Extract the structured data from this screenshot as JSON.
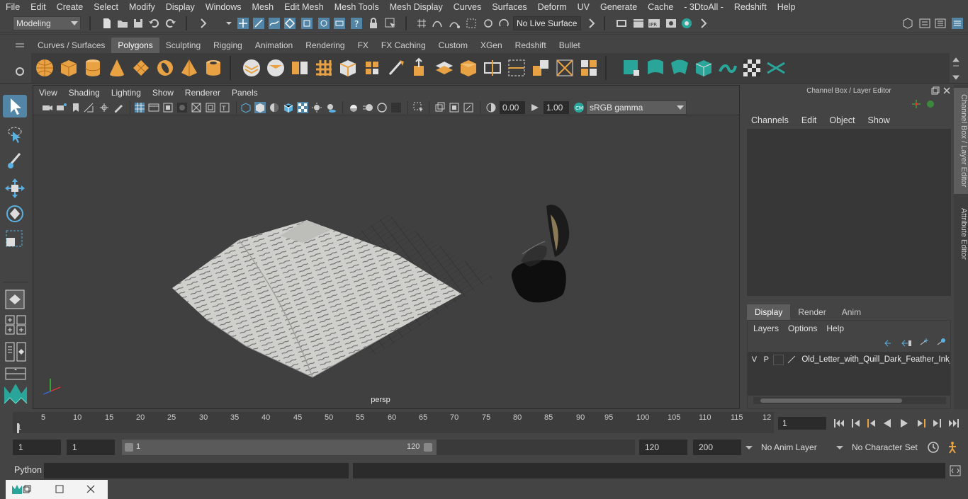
{
  "menubar": {
    "items": [
      "File",
      "Edit",
      "Create",
      "Select",
      "Modify",
      "Display",
      "Windows",
      "Mesh",
      "Edit Mesh",
      "Mesh Tools",
      "Mesh Display",
      "Curves",
      "Surfaces",
      "Deform",
      "UV",
      "Generate",
      "Cache",
      "- 3DtoAll -",
      "Redshift",
      "Help"
    ]
  },
  "statusline": {
    "mode": "Modeling",
    "live_surface": "No Live Surface"
  },
  "shelf": {
    "tabs": [
      "Curves / Surfaces",
      "Polygons",
      "Sculpting",
      "Rigging",
      "Animation",
      "Rendering",
      "FX",
      "FX Caching",
      "Custom",
      "XGen",
      "Redshift",
      "Bullet"
    ],
    "active_tab": "Polygons"
  },
  "viewport": {
    "menu": [
      "View",
      "Shading",
      "Lighting",
      "Show",
      "Renderer",
      "Panels"
    ],
    "exposure": "0.00",
    "gamma": "1.00",
    "color_space": "sRGB gamma",
    "camera_label": "persp"
  },
  "channelbox": {
    "title": "Channel Box / Layer Editor",
    "menu": [
      "Channels",
      "Edit",
      "Object",
      "Show"
    ],
    "layer_tabs": [
      "Display",
      "Render",
      "Anim"
    ],
    "active_layer_tab": "Display",
    "layer_menu": [
      "Layers",
      "Options",
      "Help"
    ],
    "layer": {
      "v": "V",
      "p": "P",
      "name": "Old_Letter_with_Quill_Dark_Feather_Ink_"
    }
  },
  "sidetabs": {
    "channel_box": "Channel Box / Layer Editor",
    "attribute_editor": "Attribute Editor"
  },
  "timeslider": {
    "ticks": [
      "1",
      "5",
      "10",
      "15",
      "20",
      "25",
      "30",
      "35",
      "40",
      "45",
      "50",
      "55",
      "60",
      "65",
      "70",
      "75",
      "80",
      "85",
      "90",
      "95",
      "100",
      "105",
      "110",
      "115",
      "12"
    ],
    "current_frame": "1"
  },
  "rangeslider": {
    "start": "1",
    "playback_start": "1",
    "range_start_label": "1",
    "range_end_label": "120",
    "playback_end": "120",
    "end": "200",
    "anim_layer": "No Anim Layer",
    "character_set": "No Character Set"
  },
  "cmdline": {
    "language": "Python"
  },
  "colors": {
    "accent": "#5285a6",
    "teal": "#2aa59a",
    "orange": "#e8a243"
  }
}
